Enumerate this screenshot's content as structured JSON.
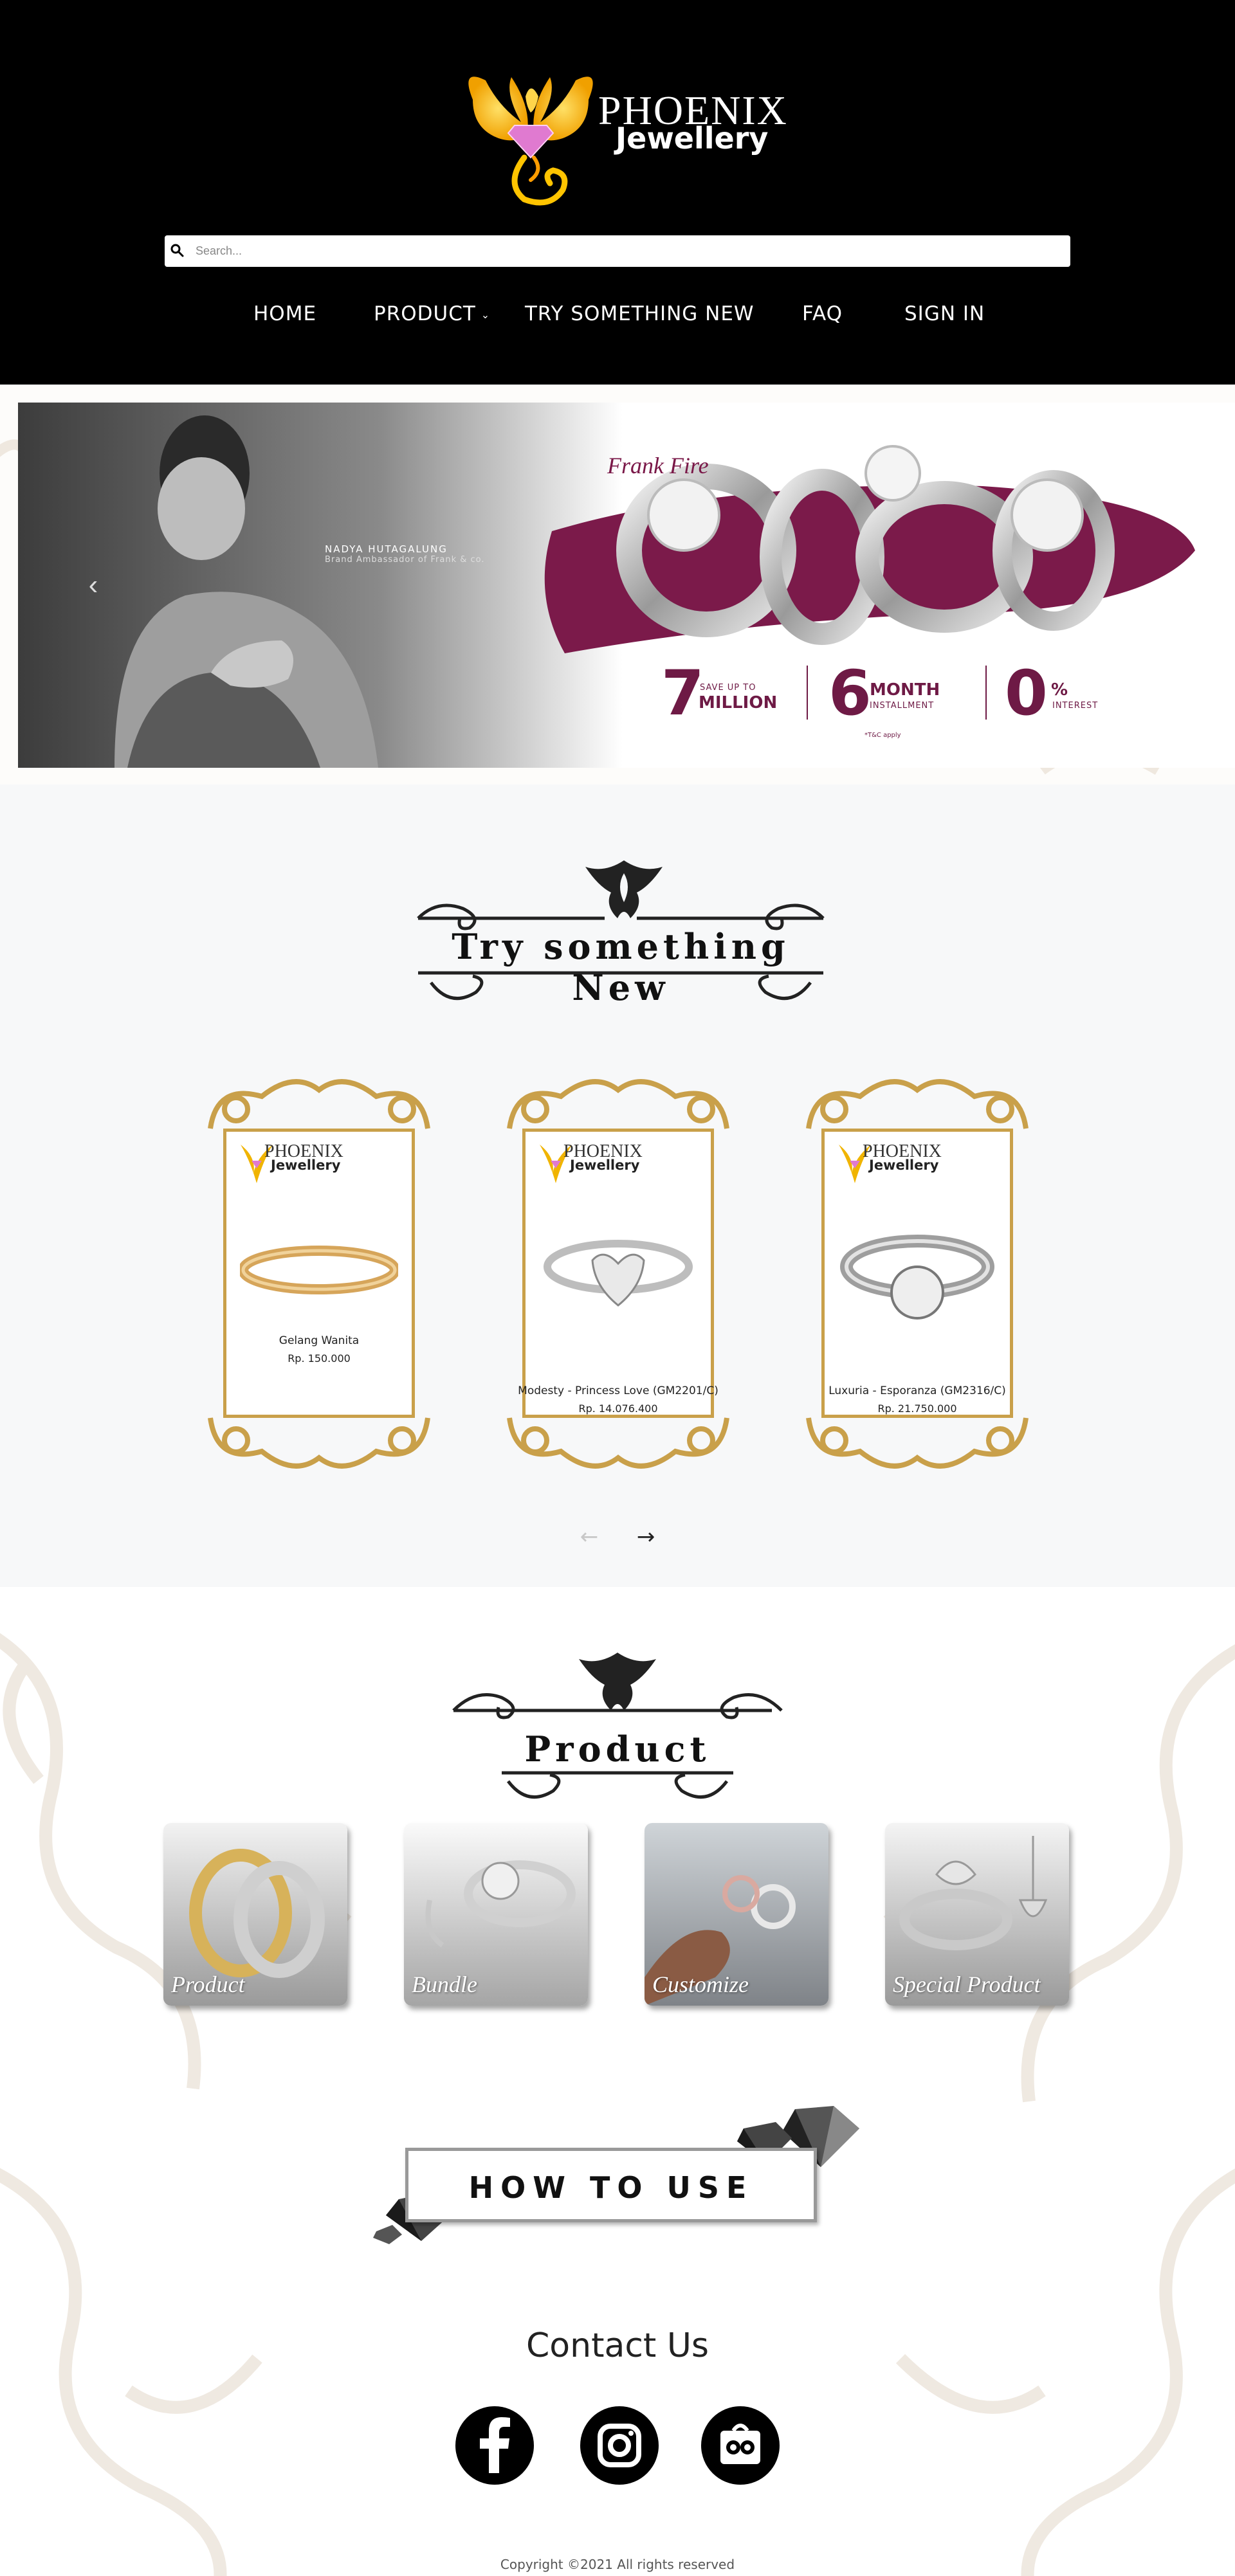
{
  "header": {
    "logo_line1": "PHOENIX",
    "logo_line2": "Jewellery",
    "search_placeholder": "Search...",
    "nav": {
      "home": "HOME",
      "product": "PRODUCT",
      "try_new": "TRY SOMETHING NEW",
      "faq": "FAQ",
      "sign_in": "SIGN IN"
    }
  },
  "hero": {
    "ambassador_name": "NADYA HUTAGALUNG",
    "ambassador_role": "Brand Ambassador of Frank & co.",
    "collection": "Frank Fire",
    "promo1_big": "7",
    "promo1_small": "SAVE UP TO",
    "promo1_mid": "MILLION",
    "promo2_big": "6",
    "promo2_mid": "MONTH",
    "promo2_small": "INSTALLMENT",
    "promo3_big": "0",
    "promo3_mid": "%",
    "promo3_small": "INTEREST",
    "tnc": "*T&C apply",
    "colors": {
      "brand": "#6e1a45"
    }
  },
  "try_new": {
    "title": "Try something New",
    "cards": [
      {
        "name": "Gelang Wanita",
        "price": "Rp. 150.000",
        "logo1": "PHOENIX",
        "logo2": "Jewellery"
      },
      {
        "name": "Modesty - Princess Love (GM2201/C)",
        "price": "Rp. 14.076.400",
        "logo1": "PHOENIX",
        "logo2": "Jewellery"
      },
      {
        "name": "Luxuria - Esporanza (GM2316/C)",
        "price": "Rp. 21.750.000",
        "logo1": "PHOENIX",
        "logo2": "Jewellery"
      }
    ],
    "prev_icon": "←",
    "next_icon": "→"
  },
  "product": {
    "title": "Product",
    "tiles": [
      "Product",
      "Bundle",
      "Customize",
      "Special Product"
    ]
  },
  "how_to_use": "HOW TO USE",
  "contact": {
    "title": "Contact Us",
    "socials": [
      "facebook-icon",
      "instagram-icon",
      "tokopedia-icon"
    ]
  },
  "footer": {
    "copyright": "Copyright ©2021 All rights reserved"
  }
}
